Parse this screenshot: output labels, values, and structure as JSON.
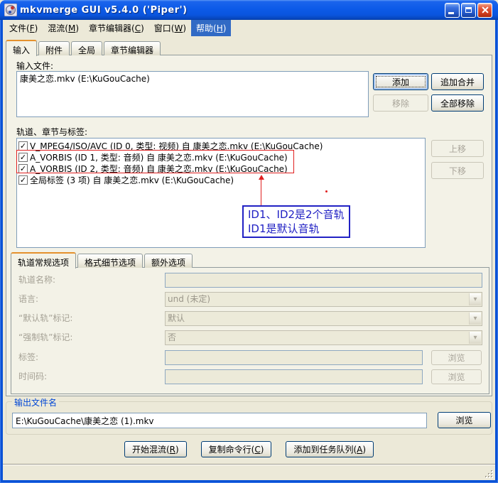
{
  "window": {
    "title": "mkvmerge GUI v5.4.0 ('Piper')"
  },
  "icons": {
    "check": "✓",
    "combo_arrow": "▾"
  },
  "menu": {
    "items": [
      {
        "pre": "文件(",
        "key": "F",
        "post": ")"
      },
      {
        "pre": "混流(",
        "key": "M",
        "post": ")"
      },
      {
        "pre": "章节编辑器(",
        "key": "C",
        "post": ")"
      },
      {
        "pre": "窗口(",
        "key": "W",
        "post": ")"
      },
      {
        "pre": "帮助(",
        "key": "H",
        "post": ")"
      }
    ],
    "highlighted": "帮助(H)"
  },
  "main_tabs": {
    "items": [
      "输入",
      "附件",
      "全局",
      "章节编辑器"
    ],
    "active": "输入"
  },
  "input_tab": {
    "input_files_label": "输入文件:",
    "files": [
      "康美之恋.mkv (E:\\KuGouCache)"
    ],
    "add_button": "添加",
    "append_button": "追加合并",
    "remove_button": "移除",
    "remove_all_button": "全部移除",
    "tracks_label": "轨道、章节与标签:",
    "tracks": [
      {
        "checked": true,
        "label": "V_MPEG4/ISO/AVC (ID 0, 类型: 视频) 自 康美之恋.mkv (E:\\KuGouCache)"
      },
      {
        "checked": true,
        "label": "A_VORBIS (ID 1, 类型: 音频) 自 康美之恋.mkv (E:\\KuGouCache)"
      },
      {
        "checked": true,
        "label": "A_VORBIS (ID 2, 类型: 音频) 自 康美之恋.mkv (E:\\KuGouCache)"
      },
      {
        "checked": true,
        "label": "全局标签 (3 项) 自 康美之恋.mkv (E:\\KuGouCache)"
      }
    ],
    "move_up_button": "上移",
    "move_down_button": "下移",
    "annotation": {
      "line1": "ID1、ID2是2个音轨",
      "line2": "ID1是默认音轨",
      "color": "#2121C4",
      "arrow_color": "#E02020"
    },
    "option_tabs": {
      "items": [
        "轨道常规选项",
        "格式细节选项",
        "额外选项"
      ],
      "active": "轨道常规选项"
    },
    "form": {
      "track_name_label": "轨道名称:",
      "track_name_value": "",
      "language_label": "语言:",
      "language_value": "und (未定)",
      "default_track_label": "“默认轨”标记:",
      "default_track_value": "默认",
      "forced_track_label": "“强制轨”标记:",
      "forced_track_value": "否",
      "tags_label": "标签:",
      "tags_value": "",
      "timecodes_label": "时间码:",
      "timecodes_value": "",
      "browse_button": "浏览"
    }
  },
  "output": {
    "group_label": "输出文件名",
    "filename": "E:\\KuGouCache\\康美之恋 (1).mkv",
    "browse_button": "浏览"
  },
  "actions": {
    "start_muxing": {
      "pre": "开始混流(",
      "key": "R",
      "post": ")"
    },
    "copy_cmdline": {
      "pre": "复制命令行(",
      "key": "C",
      "post": ")"
    },
    "add_to_jobqueue": {
      "pre": "添加到任务队列(",
      "key": "A",
      "post": ")"
    }
  }
}
